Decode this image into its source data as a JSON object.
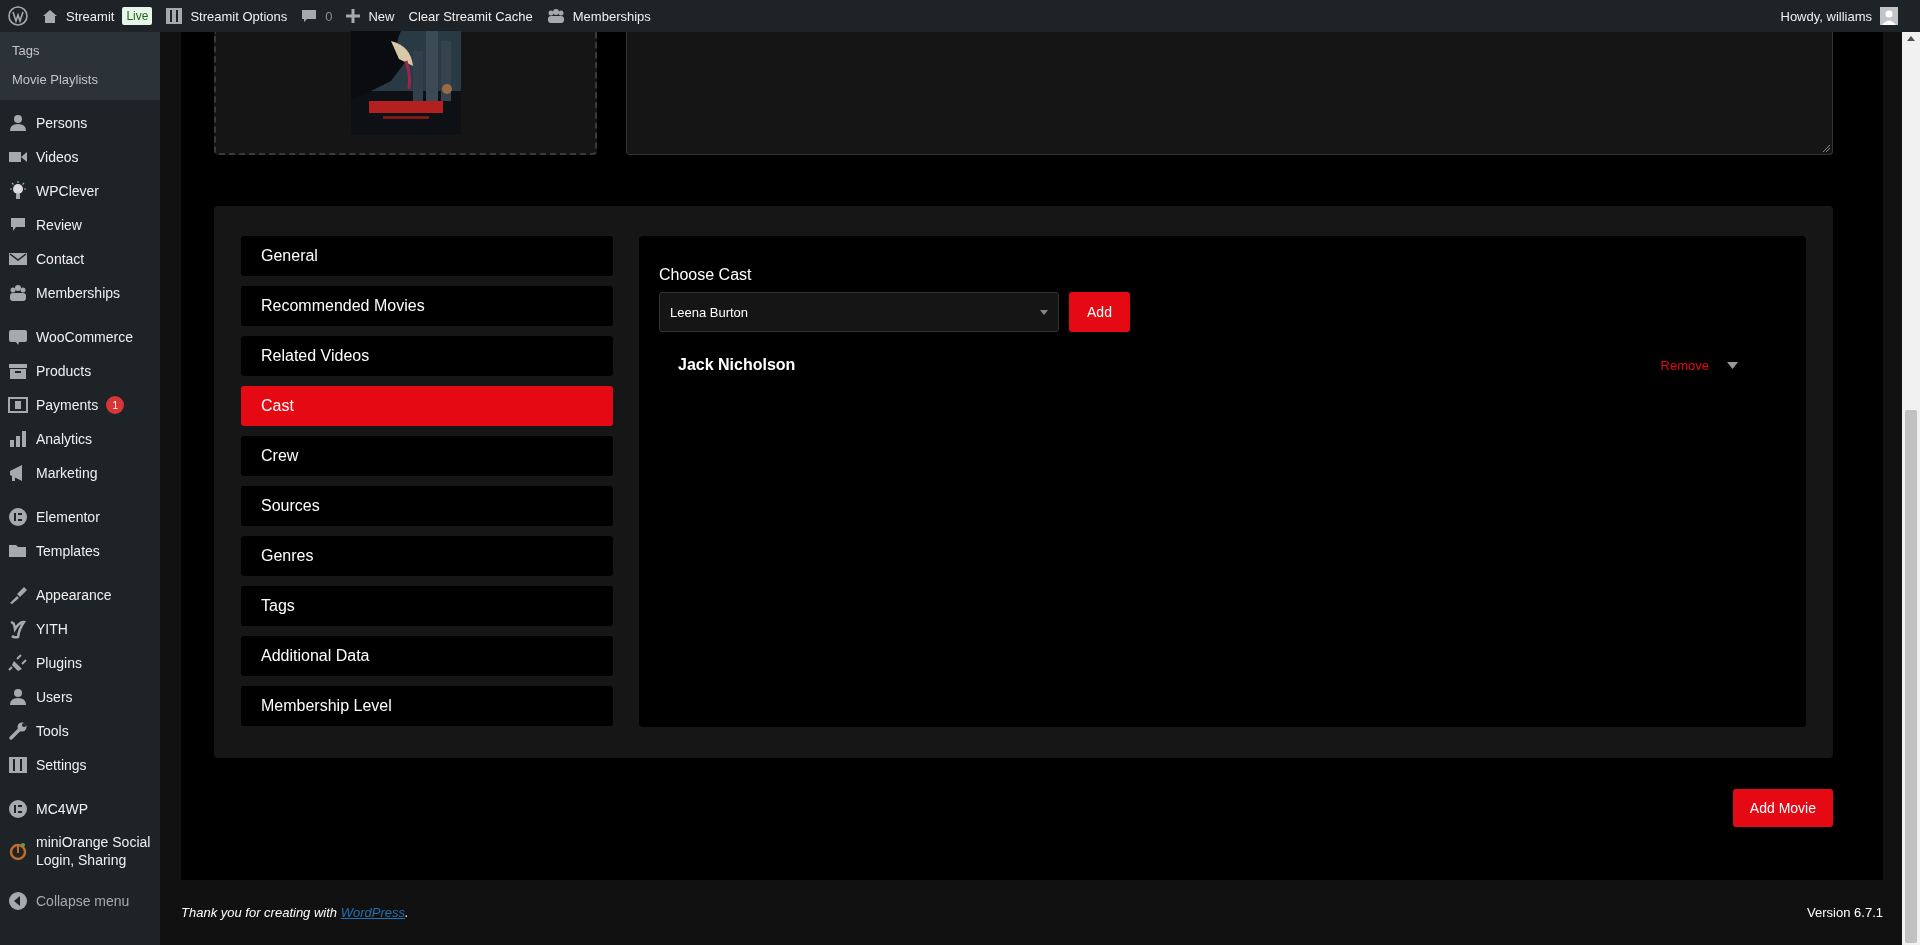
{
  "admin_bar": {
    "site": "Streamit",
    "live_badge": "Live",
    "options": "Streamit Options",
    "comments": "0",
    "new": "New",
    "clear_cache": "Clear Streamit Cache",
    "memberships": "Memberships",
    "greeting": "Howdy, williams"
  },
  "sidebar": {
    "submenu": [
      {
        "label": "Tags"
      },
      {
        "label": "Movie Playlists"
      }
    ],
    "groups": [
      [
        {
          "label": "Persons"
        },
        {
          "label": "Videos"
        },
        {
          "label": "WPClever"
        },
        {
          "label": "Review"
        },
        {
          "label": "Contact"
        },
        {
          "label": "Memberships"
        }
      ],
      [
        {
          "label": "WooCommerce"
        },
        {
          "label": "Products"
        },
        {
          "label": "Payments",
          "badge": "1"
        },
        {
          "label": "Analytics"
        },
        {
          "label": "Marketing"
        }
      ],
      [
        {
          "label": "Elementor"
        },
        {
          "label": "Templates"
        }
      ],
      [
        {
          "label": "Appearance"
        },
        {
          "label": "YITH"
        },
        {
          "label": "Plugins"
        },
        {
          "label": "Users"
        },
        {
          "label": "Tools"
        },
        {
          "label": "Settings"
        }
      ],
      [
        {
          "label": "MC4WP"
        },
        {
          "label": "miniOrange Social Login, Sharing"
        }
      ]
    ],
    "collapse": "Collapse menu"
  },
  "tabs": [
    {
      "label": "General",
      "selected": false
    },
    {
      "label": "Recommended Movies",
      "selected": false
    },
    {
      "label": "Related Videos",
      "selected": false
    },
    {
      "label": "Cast",
      "selected": true
    },
    {
      "label": "Crew",
      "selected": false
    },
    {
      "label": "Sources",
      "selected": false
    },
    {
      "label": "Genres",
      "selected": false
    },
    {
      "label": "Tags",
      "selected": false
    },
    {
      "label": "Additional Data",
      "selected": false
    },
    {
      "label": "Membership Level",
      "selected": false
    }
  ],
  "cast_panel": {
    "label": "Choose Cast",
    "select_value": "Leena Burton",
    "add_button": "Add",
    "cast": [
      {
        "name": "Jack Nicholson",
        "remove": "Remove"
      }
    ]
  },
  "add_movie_button": "Add Movie",
  "footer": {
    "thanks_prefix": "Thank you for creating with ",
    "link": "WordPress",
    "thanks_suffix": ".",
    "version": "Version 6.7.1"
  }
}
